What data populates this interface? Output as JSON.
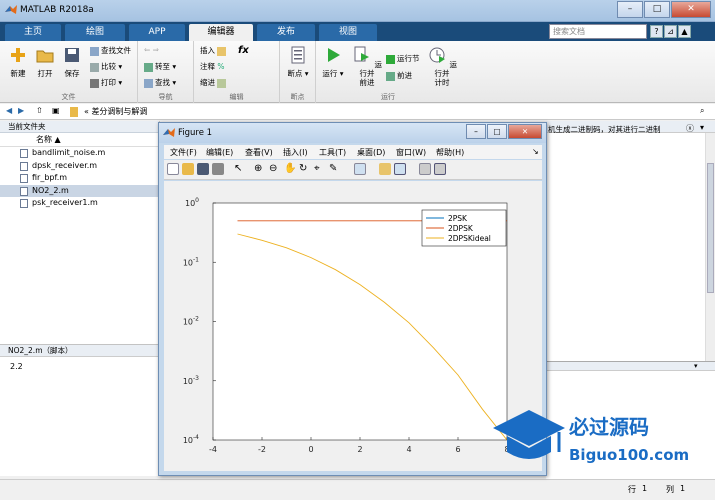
{
  "window": {
    "title": "MATLAB R2018a",
    "min": "–",
    "max": "□",
    "close": "✕"
  },
  "tabs": [
    {
      "label": "主页"
    },
    {
      "label": "绘图"
    },
    {
      "label": "APP"
    },
    {
      "label": "编辑器",
      "active": true
    },
    {
      "label": "发布"
    },
    {
      "label": "视图"
    }
  ],
  "search_placeholder": "搜索文档",
  "ribbon": {
    "file": {
      "new": "新建",
      "open": "打开",
      "save": "保存",
      "find_files": "查找文件",
      "compare": "比较",
      "print": "打印",
      "group": "文件"
    },
    "nav": {
      "goto": "转至",
      "find": "查找",
      "group": "导航"
    },
    "edit": {
      "insert": "插入",
      "comment": "注释",
      "indent": "缩进",
      "fx": "fx",
      "percent": "%",
      "group": "编辑"
    },
    "breakpoints": {
      "label": "断点",
      "group": "断点"
    },
    "run": {
      "run": "运行",
      "run_advance_1": "运行并",
      "run_advance_2": "前进",
      "run_section": "运行节",
      "advance": "前进",
      "run_time_1": "运行并",
      "run_time_2": "计时",
      "group": "运行"
    }
  },
  "address": {
    "path": "«  差分调制与解调"
  },
  "file_panel": {
    "title": "当前文件夹",
    "col_name": "名称 ▲",
    "files": [
      {
        "name": "bandlimit_noise.m"
      },
      {
        "name": "dpsk_receiver.m"
      },
      {
        "name": "fir_bpf.m"
      },
      {
        "name": "NO2_2.m",
        "selected": true
      },
      {
        "name": "psk_receiver1.m"
      }
    ]
  },
  "details": {
    "title": "NO2_2.m（脚本）",
    "value": "2.2"
  },
  "right_panel_text": "机生成二进制码，对其进行二进制",
  "status": {
    "line_label": "行",
    "line": "1",
    "col_label": "列",
    "col": "1"
  },
  "figure": {
    "title": "Figure 1",
    "menu": [
      "文件(F)",
      "编辑(E)",
      "查看(V)",
      "插入(I)",
      "工具(T)",
      "桌面(D)",
      "窗口(W)",
      "帮助(H)"
    ]
  },
  "chart_data": {
    "type": "line",
    "yscale": "log",
    "xlim": [
      -4,
      8
    ],
    "ylim": [
      0.0001,
      1
    ],
    "xticks": [
      "-4",
      "-2",
      "0",
      "2",
      "4",
      "6",
      "8"
    ],
    "yticks": [
      "10^0",
      "10^-1",
      "10^-2",
      "10^-3",
      "10^-4"
    ],
    "legend_position": "top-right",
    "series": [
      {
        "name": "2PSK",
        "color": "#0072BD",
        "x": [],
        "y": []
      },
      {
        "name": "2DPSK",
        "color": "#D95319",
        "x": [
          -3,
          0,
          2,
          4,
          6,
          8
        ],
        "y": [
          0.5,
          0.5,
          0.5,
          0.5,
          0.5,
          0.5
        ]
      },
      {
        "name": "2DPSKideal",
        "color": "#EDB120",
        "x": [
          -3,
          -2,
          -1,
          0,
          1,
          2,
          3,
          4,
          5,
          6,
          7,
          8
        ],
        "y": [
          0.3,
          0.235,
          0.175,
          0.12,
          0.075,
          0.042,
          0.021,
          0.0095,
          0.0036,
          0.00125,
          0.00033,
          6e-05
        ]
      }
    ]
  },
  "watermark": {
    "cn": "必过源码",
    "en": "Biguo100.com"
  },
  "colors": {
    "ribbon_tab_bg": "#1a4b7a",
    "figure_frame": "#c4d8ec"
  }
}
